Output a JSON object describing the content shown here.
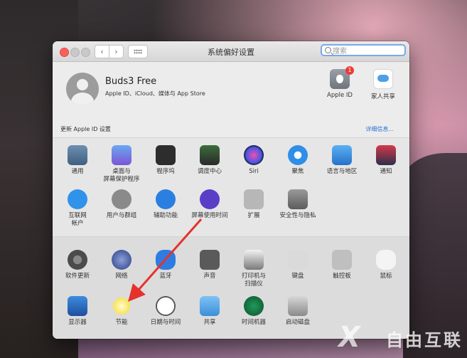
{
  "window": {
    "title": "系统偏好设置",
    "search_placeholder": "搜索"
  },
  "account": {
    "name": "Buds3 Free",
    "subtitle": "Apple ID、iCloud、媒体与 App Store",
    "apple_id_label": "Apple ID",
    "apple_id_badge": "1",
    "family_label": "家人共享"
  },
  "update_bar": {
    "text": "更新 Apple ID 设置",
    "details_link": "详细信息..."
  },
  "section1": [
    {
      "label": "通用",
      "icon": "general-icon"
    },
    {
      "label": "桌面与\n屏幕保护程序",
      "icon": "desktop-icon"
    },
    {
      "label": "程序坞",
      "icon": "dock-icon"
    },
    {
      "label": "调度中心",
      "icon": "mission-control-icon"
    },
    {
      "label": "Siri",
      "icon": "siri-icon"
    },
    {
      "label": "聚焦",
      "icon": "spotlight-icon"
    },
    {
      "label": "语言与地区",
      "icon": "language-icon"
    },
    {
      "label": "通知",
      "icon": "notifications-icon"
    },
    {
      "label": "互联网\n帐户",
      "icon": "internet-accounts-icon"
    },
    {
      "label": "用户与群组",
      "icon": "users-icon"
    },
    {
      "label": "辅助功能",
      "icon": "accessibility-icon"
    },
    {
      "label": "屏幕使用时间",
      "icon": "screen-time-icon"
    },
    {
      "label": "扩展",
      "icon": "extensions-icon"
    },
    {
      "label": "安全性与隐私",
      "icon": "security-icon"
    }
  ],
  "section2": [
    {
      "label": "软件更新",
      "icon": "software-update-icon"
    },
    {
      "label": "网络",
      "icon": "network-icon"
    },
    {
      "label": "蓝牙",
      "icon": "bluetooth-icon"
    },
    {
      "label": "声音",
      "icon": "sound-icon"
    },
    {
      "label": "打印机与\n扫描仪",
      "icon": "printer-icon"
    },
    {
      "label": "键盘",
      "icon": "keyboard-icon"
    },
    {
      "label": "触控板",
      "icon": "trackpad-icon"
    },
    {
      "label": "鼠标",
      "icon": "mouse-icon"
    },
    {
      "label": "显示器",
      "icon": "display-icon"
    },
    {
      "label": "节能",
      "icon": "energy-saver-icon"
    },
    {
      "label": "日期与时间",
      "icon": "date-time-icon"
    },
    {
      "label": "共享",
      "icon": "sharing-icon"
    },
    {
      "label": "时间机器",
      "icon": "time-machine-icon"
    },
    {
      "label": "启动磁盘",
      "icon": "startup-disk-icon"
    }
  ],
  "watermark": "自由互联",
  "colors": {
    "accent": "#2f6fd6",
    "annotation_arrow": "#e5322d"
  }
}
